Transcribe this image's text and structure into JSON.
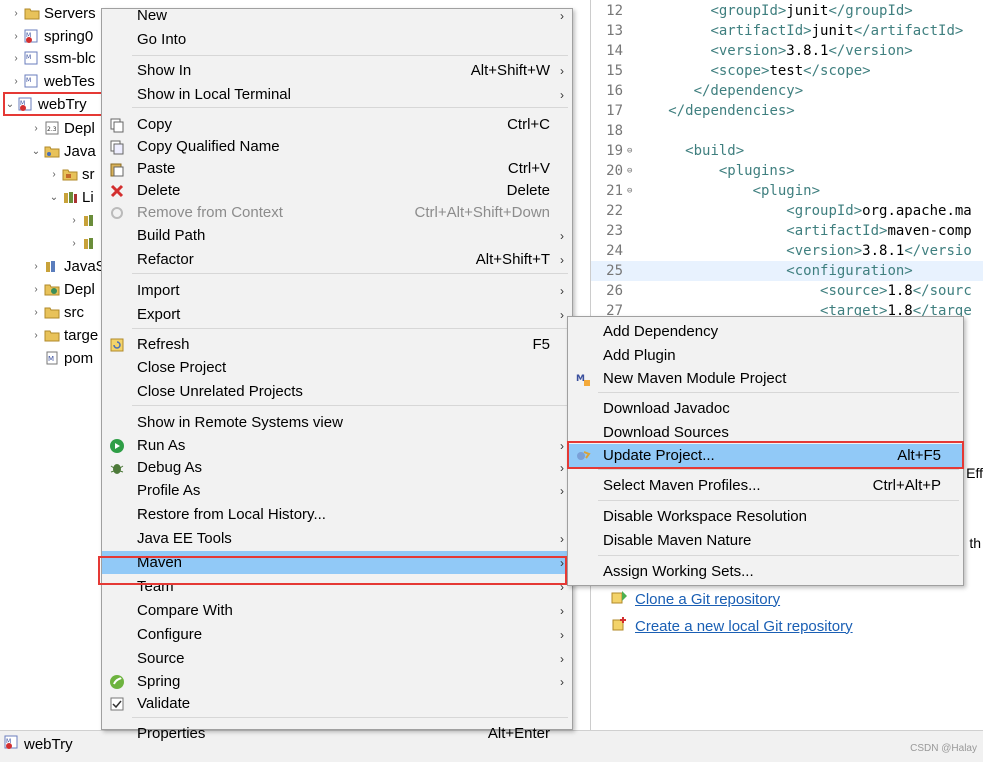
{
  "explorer": {
    "items": [
      {
        "label": "Servers",
        "icon": "folder-icon"
      },
      {
        "label": "spring0",
        "icon": "maven-project-error-icon"
      },
      {
        "label": "ssm-blc",
        "icon": "maven-project-icon"
      },
      {
        "label": "webTes",
        "icon": "maven-project-icon"
      },
      {
        "label": "webTry",
        "icon": "maven-project-error-icon"
      },
      {
        "label": "Depl",
        "icon": "deployment-descriptor-icon"
      },
      {
        "label": "Java",
        "icon": "java-resources-icon"
      },
      {
        "label": "sr",
        "icon": "source-folder-icon"
      },
      {
        "label": "Li",
        "icon": "libraries-icon"
      },
      {
        "label": "",
        "icon": "library-jar-icon"
      },
      {
        "label": "",
        "icon": "library-jar-icon"
      },
      {
        "label": "JavaS",
        "icon": "javascript-resources-icon"
      },
      {
        "label": "Depl",
        "icon": "deployed-resources-icon"
      },
      {
        "label": "src",
        "icon": "folder-icon"
      },
      {
        "label": "targe",
        "icon": "folder-icon"
      },
      {
        "label": "pom",
        "icon": "pom-file-icon"
      }
    ]
  },
  "editor": {
    "lines": [
      {
        "num": "12",
        "pre": "        ",
        "open": "<groupId>",
        "text": "junit",
        "close": "</groupId>"
      },
      {
        "num": "13",
        "pre": "        ",
        "open": "<artifactId>",
        "text": "junit",
        "close": "</artifactId>"
      },
      {
        "num": "14",
        "pre": "        ",
        "open": "<version>",
        "text": "3.8.1",
        "close": "</version>"
      },
      {
        "num": "15",
        "pre": "        ",
        "open": "<scope>",
        "text": "test",
        "close": "</scope>"
      },
      {
        "num": "16",
        "pre": "      ",
        "open": "</dependency>",
        "text": "",
        "close": ""
      },
      {
        "num": "17",
        "pre": "   ",
        "open": "</dependencies>",
        "text": "",
        "close": ""
      },
      {
        "num": "18",
        "pre": "",
        "open": "",
        "text": "",
        "close": ""
      },
      {
        "num": "19",
        "pre": "     ",
        "open": "<build>",
        "text": "",
        "close": ""
      },
      {
        "num": "20",
        "pre": "         ",
        "open": "<plugins>",
        "text": "",
        "close": ""
      },
      {
        "num": "21",
        "pre": "             ",
        "open": "<plugin>",
        "text": "",
        "close": ""
      },
      {
        "num": "22",
        "pre": "                 ",
        "open": "<groupId>",
        "text": "org.apache.ma",
        "close": ""
      },
      {
        "num": "23",
        "pre": "                 ",
        "open": "<artifactId>",
        "text": "maven-comp",
        "close": ""
      },
      {
        "num": "24",
        "pre": "                 ",
        "open": "<version>",
        "text": "3.8.1",
        "close": "</versio"
      },
      {
        "num": "25",
        "pre": "                 ",
        "open": "<configuration>",
        "text": "",
        "close": ""
      },
      {
        "num": "26",
        "pre": "                     ",
        "open": "<source>",
        "text": "1.8",
        "close": "</sourc"
      },
      {
        "num": "27",
        "pre": "                     ",
        "open": "<target>",
        "text": "1.8",
        "close": "</targe"
      }
    ]
  },
  "git": {
    "clone_label": "Clone a Git repository",
    "create_label": "Create a new local Git repository",
    "right_fragments": [
      "Eff",
      "th"
    ]
  },
  "context_menu": {
    "items": [
      {
        "label": "New",
        "shortcut": "",
        "submenu": true,
        "icon": ""
      },
      {
        "label": "Go Into",
        "shortcut": "",
        "submenu": false,
        "icon": ""
      },
      {
        "label": "Show In",
        "shortcut": "Alt+Shift+W",
        "submenu": true,
        "icon": ""
      },
      {
        "label": "Show in Local Terminal",
        "shortcut": "",
        "submenu": true,
        "icon": ""
      },
      {
        "label": "Copy",
        "shortcut": "Ctrl+C",
        "submenu": false,
        "icon": "copy-icon"
      },
      {
        "label": "Copy Qualified Name",
        "shortcut": "",
        "submenu": false,
        "icon": "copy-qualified-icon"
      },
      {
        "label": "Paste",
        "shortcut": "Ctrl+V",
        "submenu": false,
        "icon": "paste-icon"
      },
      {
        "label": "Delete",
        "shortcut": "Delete",
        "submenu": false,
        "icon": "delete-icon"
      },
      {
        "label": "Remove from Context",
        "shortcut": "Ctrl+Alt+Shift+Down",
        "submenu": false,
        "icon": "remove-context-icon",
        "disabled": true
      },
      {
        "label": "Build Path",
        "shortcut": "",
        "submenu": true,
        "icon": ""
      },
      {
        "label": "Refactor",
        "shortcut": "Alt+Shift+T",
        "submenu": true,
        "icon": ""
      },
      {
        "label": "Import",
        "shortcut": "",
        "submenu": true,
        "icon": ""
      },
      {
        "label": "Export",
        "shortcut": "",
        "submenu": true,
        "icon": ""
      },
      {
        "label": "Refresh",
        "shortcut": "F5",
        "submenu": false,
        "icon": "refresh-icon"
      },
      {
        "label": "Close Project",
        "shortcut": "",
        "submenu": false,
        "icon": ""
      },
      {
        "label": "Close Unrelated Projects",
        "shortcut": "",
        "submenu": false,
        "icon": ""
      },
      {
        "label": "Show in Remote Systems view",
        "shortcut": "",
        "submenu": false,
        "icon": ""
      },
      {
        "label": "Run As",
        "shortcut": "",
        "submenu": true,
        "icon": "run-icon"
      },
      {
        "label": "Debug As",
        "shortcut": "",
        "submenu": true,
        "icon": "debug-icon"
      },
      {
        "label": "Profile As",
        "shortcut": "",
        "submenu": true,
        "icon": ""
      },
      {
        "label": "Restore from Local History...",
        "shortcut": "",
        "submenu": false,
        "icon": ""
      },
      {
        "label": "Java EE Tools",
        "shortcut": "",
        "submenu": true,
        "icon": ""
      },
      {
        "label": "Maven",
        "shortcut": "",
        "submenu": true,
        "icon": "",
        "active": true
      },
      {
        "label": "Team",
        "shortcut": "",
        "submenu": true,
        "icon": ""
      },
      {
        "label": "Compare With",
        "shortcut": "",
        "submenu": true,
        "icon": ""
      },
      {
        "label": "Configure",
        "shortcut": "",
        "submenu": true,
        "icon": ""
      },
      {
        "label": "Source",
        "shortcut": "",
        "submenu": true,
        "icon": ""
      },
      {
        "label": "Spring",
        "shortcut": "",
        "submenu": true,
        "icon": "spring-icon"
      },
      {
        "label": "Validate",
        "shortcut": "",
        "submenu": false,
        "icon": "validate-checkbox-icon"
      },
      {
        "label": "Properties",
        "shortcut": "Alt+Enter",
        "submenu": false,
        "icon": ""
      }
    ]
  },
  "maven_submenu": {
    "items": [
      {
        "label": "Add Dependency",
        "shortcut": "",
        "icon": ""
      },
      {
        "label": "Add Plugin",
        "shortcut": "",
        "icon": ""
      },
      {
        "label": "New Maven Module Project",
        "shortcut": "",
        "icon": "maven-module-icon"
      },
      {
        "label": "Download Javadoc",
        "shortcut": "",
        "icon": ""
      },
      {
        "label": "Download Sources",
        "shortcut": "",
        "icon": ""
      },
      {
        "label": "Update Project...",
        "shortcut": "Alt+F5",
        "icon": "update-project-icon",
        "active": true
      },
      {
        "label": "Select Maven Profiles...",
        "shortcut": "Ctrl+Alt+P",
        "icon": ""
      },
      {
        "label": "Disable Workspace Resolution",
        "shortcut": "",
        "icon": ""
      },
      {
        "label": "Disable Maven Nature",
        "shortcut": "",
        "icon": ""
      },
      {
        "label": "Assign Working Sets...",
        "shortcut": "",
        "icon": ""
      }
    ]
  },
  "statusbar": {
    "project_label": "webTry",
    "watermark": "CSDN @Halay"
  }
}
